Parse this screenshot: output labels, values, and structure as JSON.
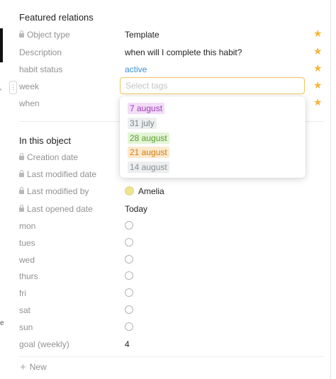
{
  "featured": {
    "title": "Featured relations",
    "rows": [
      {
        "label": "Object type",
        "value": "Template"
      },
      {
        "label": "Description",
        "value": "when will I complete this habit?"
      },
      {
        "label": "habit status",
        "value": "active"
      },
      {
        "label": "week"
      },
      {
        "label": "when"
      }
    ]
  },
  "tag_picker": {
    "placeholder": "Select tags",
    "options": [
      {
        "label": "7 august",
        "bg": "#f3dcf7",
        "fg": "#9c3fb3"
      },
      {
        "label": "31 july",
        "bg": "#eceeef",
        "fg": "#7d8589"
      },
      {
        "label": "28 august",
        "bg": "#e3f5d6",
        "fg": "#5a9c2e"
      },
      {
        "label": "21 august",
        "bg": "#fde9cc",
        "fg": "#d07d1a"
      },
      {
        "label": "14 august",
        "bg": "#eceeef",
        "fg": "#8a9094"
      }
    ]
  },
  "object": {
    "title": "In this object",
    "rows": [
      {
        "label": "Creation date"
      },
      {
        "label": "Last modified date"
      },
      {
        "label": "Last modified by",
        "value": "Amelia"
      },
      {
        "label": "Last opened date",
        "value": "Today"
      },
      {
        "label": "mon"
      },
      {
        "label": "tues"
      },
      {
        "label": "wed"
      },
      {
        "label": "thurs"
      },
      {
        "label": "fri"
      },
      {
        "label": "sat"
      },
      {
        "label": "sun"
      },
      {
        "label": "goal (weekly)",
        "value": "4"
      }
    ]
  },
  "new_label": "New",
  "colors": {
    "accent": "#f2c35b",
    "star": "#f5b63a",
    "link": "#3a8fd6"
  }
}
